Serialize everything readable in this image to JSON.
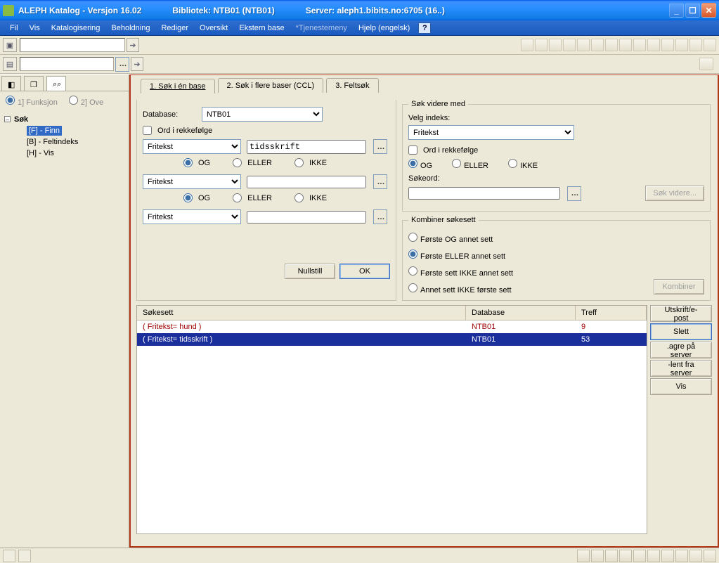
{
  "window": {
    "title_app": "ALEPH Katalog - Versjon 16.02",
    "title_lib": "Bibliotek:  NTB01 (NTB01)",
    "title_srv": "Server:  aleph1.bibits.no:6705 (16..)"
  },
  "menu": {
    "fil": "Fil",
    "vis": "Vis",
    "katalog": "Katalogisering",
    "beholdning": "Beholdning",
    "rediger": "Rediger",
    "oversikt": "Oversikt",
    "ekstern": "Ekstern base",
    "tjeneste": "*Tjenestemeny",
    "hjelp": "Hjelp (engelsk)"
  },
  "left": {
    "radio1": "1] Funksjon",
    "radio2": "2] Ove",
    "root": "Søk",
    "items": [
      "[F] - Finn",
      "[B] - Feltindeks",
      "[H] - Vis"
    ]
  },
  "tabs": {
    "t1": "1. Søk i én base",
    "t2": "2. Søk i flere baser (CCL)",
    "t3": "3. Feltsøk"
  },
  "search": {
    "database_label": "Database:",
    "database_value": "NTB01",
    "ord_label": "Ord i rekkefølge",
    "index_options": "Fritekst",
    "term1": "tidsskrift",
    "term2": "",
    "term3": "",
    "og": "OG",
    "eller": "ELLER",
    "ikke": "IKKE",
    "nullstill": "Nullstill",
    "ok": "OK"
  },
  "further": {
    "legend": "Søk videre med",
    "velg": "Velg indeks:",
    "index": "Fritekst",
    "ord": "Ord i rekkefølge",
    "og": "OG",
    "eller": "ELLER",
    "ikke": "IKKE",
    "sokeord": "Søkeord:",
    "value": "",
    "btn": "Søk videre..."
  },
  "combine": {
    "legend": "Kombiner søkesett",
    "o1": "Første OG annet sett",
    "o2": "Første ELLER annet sett",
    "o3": "Første sett IKKE annet sett",
    "o4": "Annet sett IKKE første sett",
    "btn": "Kombiner"
  },
  "results": {
    "h_q": "Søkesett",
    "h_db": "Database",
    "h_h": "Treff",
    "rows": [
      {
        "q": "( Fritekst= hund )",
        "db": "NTB01",
        "h": "9",
        "cls": "red"
      },
      {
        "q": "( Fritekst= tidsskrift )",
        "db": "NTB01",
        "h": "53",
        "cls": "sel"
      }
    ]
  },
  "sidebtns": {
    "b1": "Utskrift/e-post",
    "b2": "Slett",
    "b3": ".agre på server",
    "b4": "-lent fra server",
    "b5": "Vis"
  }
}
